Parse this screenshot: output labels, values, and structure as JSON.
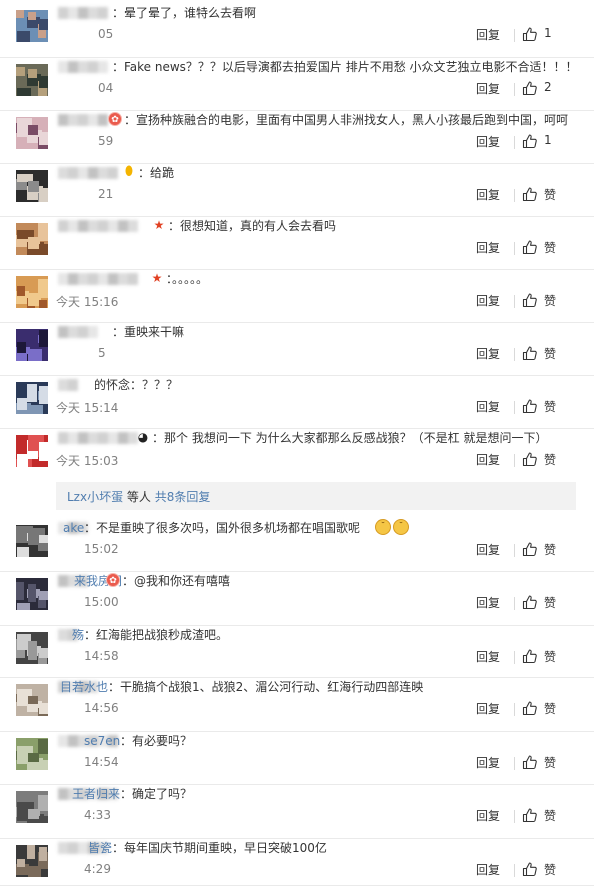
{
  "ui": {
    "reply_label": "回复",
    "like_label": "赞"
  },
  "comments": [
    {
      "text": "：晕了晕了，谁特么去看啊",
      "time": "05",
      "likes": "1",
      "badge": ""
    },
    {
      "text": "：Fake  news？？？以后导演都去拍爱国片  排片不用愁  小众文艺独立电影不合适！！！",
      "time": "04",
      "likes": "2",
      "badge": ""
    },
    {
      "text": "：宣扬种族融合的电影，里面有中国男人非洲找女人，黑人小孩最后跑到中国，呵呵",
      "time": "59",
      "likes": "1",
      "badge": "cookie"
    },
    {
      "text": "：给跪",
      "time": "21",
      "likes": "赞",
      "badge": "balloon"
    },
    {
      "text": "：很想知道，真的有人会去看吗",
      "time": "",
      "likes": "赞",
      "badge": "star"
    },
    {
      "text": "：。。。。。",
      "time": "今天 15:16",
      "likes": "赞",
      "badge": "star"
    },
    {
      "text": "：重映来干嘛",
      "time": "5",
      "likes": "赞",
      "badge": ""
    },
    {
      "text": "的怀念：？？？",
      "time": "今天 15:14",
      "likes": "赞",
      "badge": ""
    },
    {
      "text": "：那个 我想问一下 为什么大家都那么反感战狼？（不是杠 就是想问一下）",
      "time": "今天 15:03",
      "likes": "赞",
      "badge": "panda"
    },
    {
      "text": "：不是重映了很多次吗，国外很多机场都在唱国歌呢",
      "time": "15:02",
      "likes": "赞",
      "badge": "",
      "name_tail": "ake"
    },
    {
      "text": "：@我和你还有嘻嘻",
      "time": "15:00",
      "likes": "赞",
      "badge": "cookie",
      "name_tail": "来我房间"
    },
    {
      "text": "：红海能把战狼秒成渣吧。",
      "time": "14:58",
      "likes": "赞",
      "badge": "",
      "name_tail": "殇"
    },
    {
      "text": "：干脆搞个战狼1、战狼2、湄公河行动、红海行动四部连映",
      "time": "14:56",
      "likes": "赞",
      "badge": "",
      "name_tail": "目若水也"
    },
    {
      "text": "：有必要吗？",
      "time": "14:54",
      "likes": "赞",
      "badge": "",
      "name_tail": "se7en"
    },
    {
      "text": "：确定了吗？",
      "time": "4:33",
      "likes": "赞",
      "badge": "",
      "name_tail": "王者归来"
    },
    {
      "text": "：每年国庆节期间重映，早日突破100亿",
      "time": "4:29",
      "likes": "赞",
      "badge": "",
      "name_tail": "皆瓷"
    }
  ],
  "more_replies": {
    "user": "Lzx小坏蛋",
    "mid": " 等人 ",
    "link": "共8条回复"
  },
  "colors": {
    "link": "#507daf",
    "star": "#e14123",
    "time": "#808080"
  }
}
